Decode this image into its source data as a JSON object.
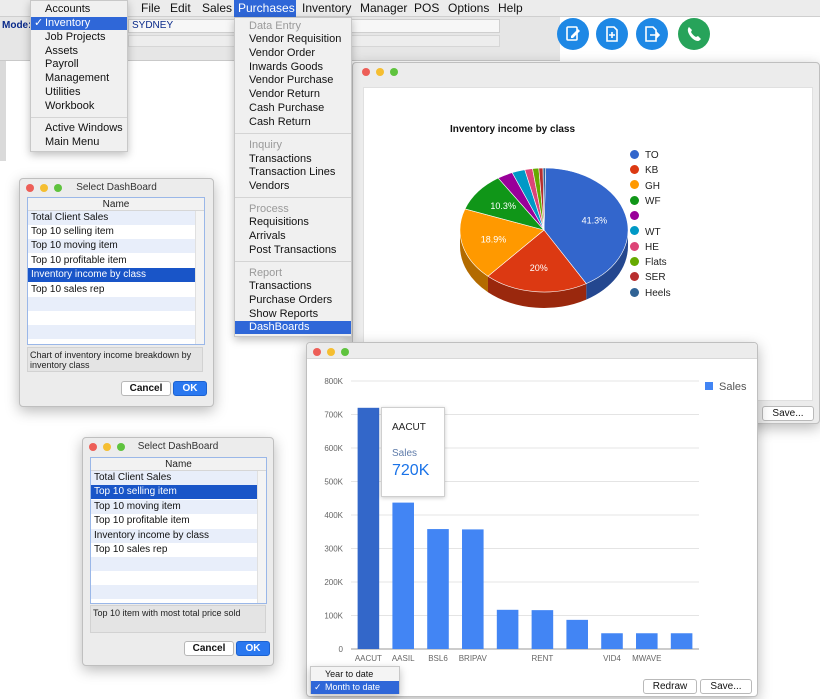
{
  "menubar": {
    "items": [
      "File",
      "Edit",
      "Sales",
      "Purchases",
      "Inventory",
      "Manager",
      "POS",
      "Options",
      "Help"
    ],
    "active": "Purchases"
  },
  "main": {
    "mode_label": "Mode:",
    "location": "SYDNEY"
  },
  "toolbar_icons": [
    "edit-document-icon",
    "add-document-icon",
    "export-document-icon",
    "phone-icon"
  ],
  "module_menu": {
    "items": [
      "Accounts",
      "Inventory",
      "Job Projects",
      "Assets",
      "Payroll",
      "Management",
      "Utilities",
      "Workbook",
      "Active Windows",
      "Main Menu"
    ],
    "checked": "Inventory"
  },
  "purchases_menu": {
    "data_entry_header": "Data Entry",
    "data_entry": [
      "Vendor Requisition",
      "Vendor Order",
      "Inwards Goods",
      "Vendor Purchase",
      "Vendor Return",
      "Cash Purchase",
      "Cash Return"
    ],
    "inquiry_header": "Inquiry",
    "inquiry": [
      "Transactions",
      "Transaction Lines",
      "Vendors"
    ],
    "process_header": "Process",
    "process": [
      "Requisitions",
      "Arrivals",
      "Post Transactions"
    ],
    "report_header": "Report",
    "report": [
      "Transactions",
      "Purchase Orders",
      "Show Reports",
      "DashBoards"
    ],
    "selected": "DashBoards"
  },
  "dialog1": {
    "title": "Select DashBoard",
    "column": "Name",
    "rows": [
      "Total Client Sales",
      "Top 10 selling item",
      "Top 10 moving item",
      "Top 10 profitable item",
      "Inventory income by class",
      "Top 10 sales rep"
    ],
    "selected_index": 4,
    "description": "Chart of inventory income breakdown by inventory class",
    "cancel_label": "Cancel",
    "ok_label": "OK"
  },
  "dialog2": {
    "title": "Select DashBoard",
    "column": "Name",
    "rows": [
      "Total Client Sales",
      "Top 10 selling item",
      "Top 10 moving item",
      "Top 10 profitable item",
      "Inventory income by class",
      "Top 10 sales rep"
    ],
    "selected_index": 1,
    "description": "Top 10 item with most total price sold",
    "cancel_label": "Cancel",
    "ok_label": "OK"
  },
  "pie_window": {
    "save_label": "Save..."
  },
  "bar_window": {
    "redraw_label": "Redraw",
    "save_label": "Save...",
    "tooltip": {
      "name": "AACUT",
      "series": "Sales",
      "value": "720K"
    },
    "period_options": [
      "Year to date",
      "Month to date"
    ],
    "period_selected": "Month to date"
  },
  "chart_data": [
    {
      "type": "pie",
      "title": "Inventory income by class",
      "labels": [
        "TO",
        "KB",
        "GH",
        "WF",
        "",
        "WT",
        "HE",
        "Flats",
        "SER",
        "Heels"
      ],
      "values": [
        41.3,
        20,
        18.9,
        10.3,
        3.0,
        2.5,
        1.5,
        1.2,
        0.8,
        0.5
      ],
      "data_labels": [
        "41.3%",
        "20%",
        "18.9%",
        "10.3%"
      ],
      "colors": [
        "#3366cc",
        "#dc3912",
        "#ff9900",
        "#109618",
        "#990099",
        "#0099c6",
        "#dd4477",
        "#66aa00",
        "#b82e2e",
        "#316395"
      ],
      "legend": "right"
    },
    {
      "type": "bar",
      "title": "",
      "categories": [
        "AACUT",
        "AASIL",
        "BSL6",
        "BRIPAV",
        "",
        "RENT",
        "",
        "VID4",
        "MWAVE",
        ""
      ],
      "series": [
        {
          "name": "Sales",
          "values": [
            720000,
            437000,
            358000,
            357000,
            117000,
            116000,
            87000,
            47000,
            47000,
            47000
          ]
        }
      ],
      "highlighted_index": 0,
      "ylim": [
        0,
        800000
      ],
      "yticks": [
        "0",
        "100K",
        "200K",
        "300K",
        "400K",
        "500K",
        "600K",
        "700K",
        "800K"
      ],
      "grid": true,
      "legend": "top-right",
      "color": "#4285f4"
    }
  ]
}
